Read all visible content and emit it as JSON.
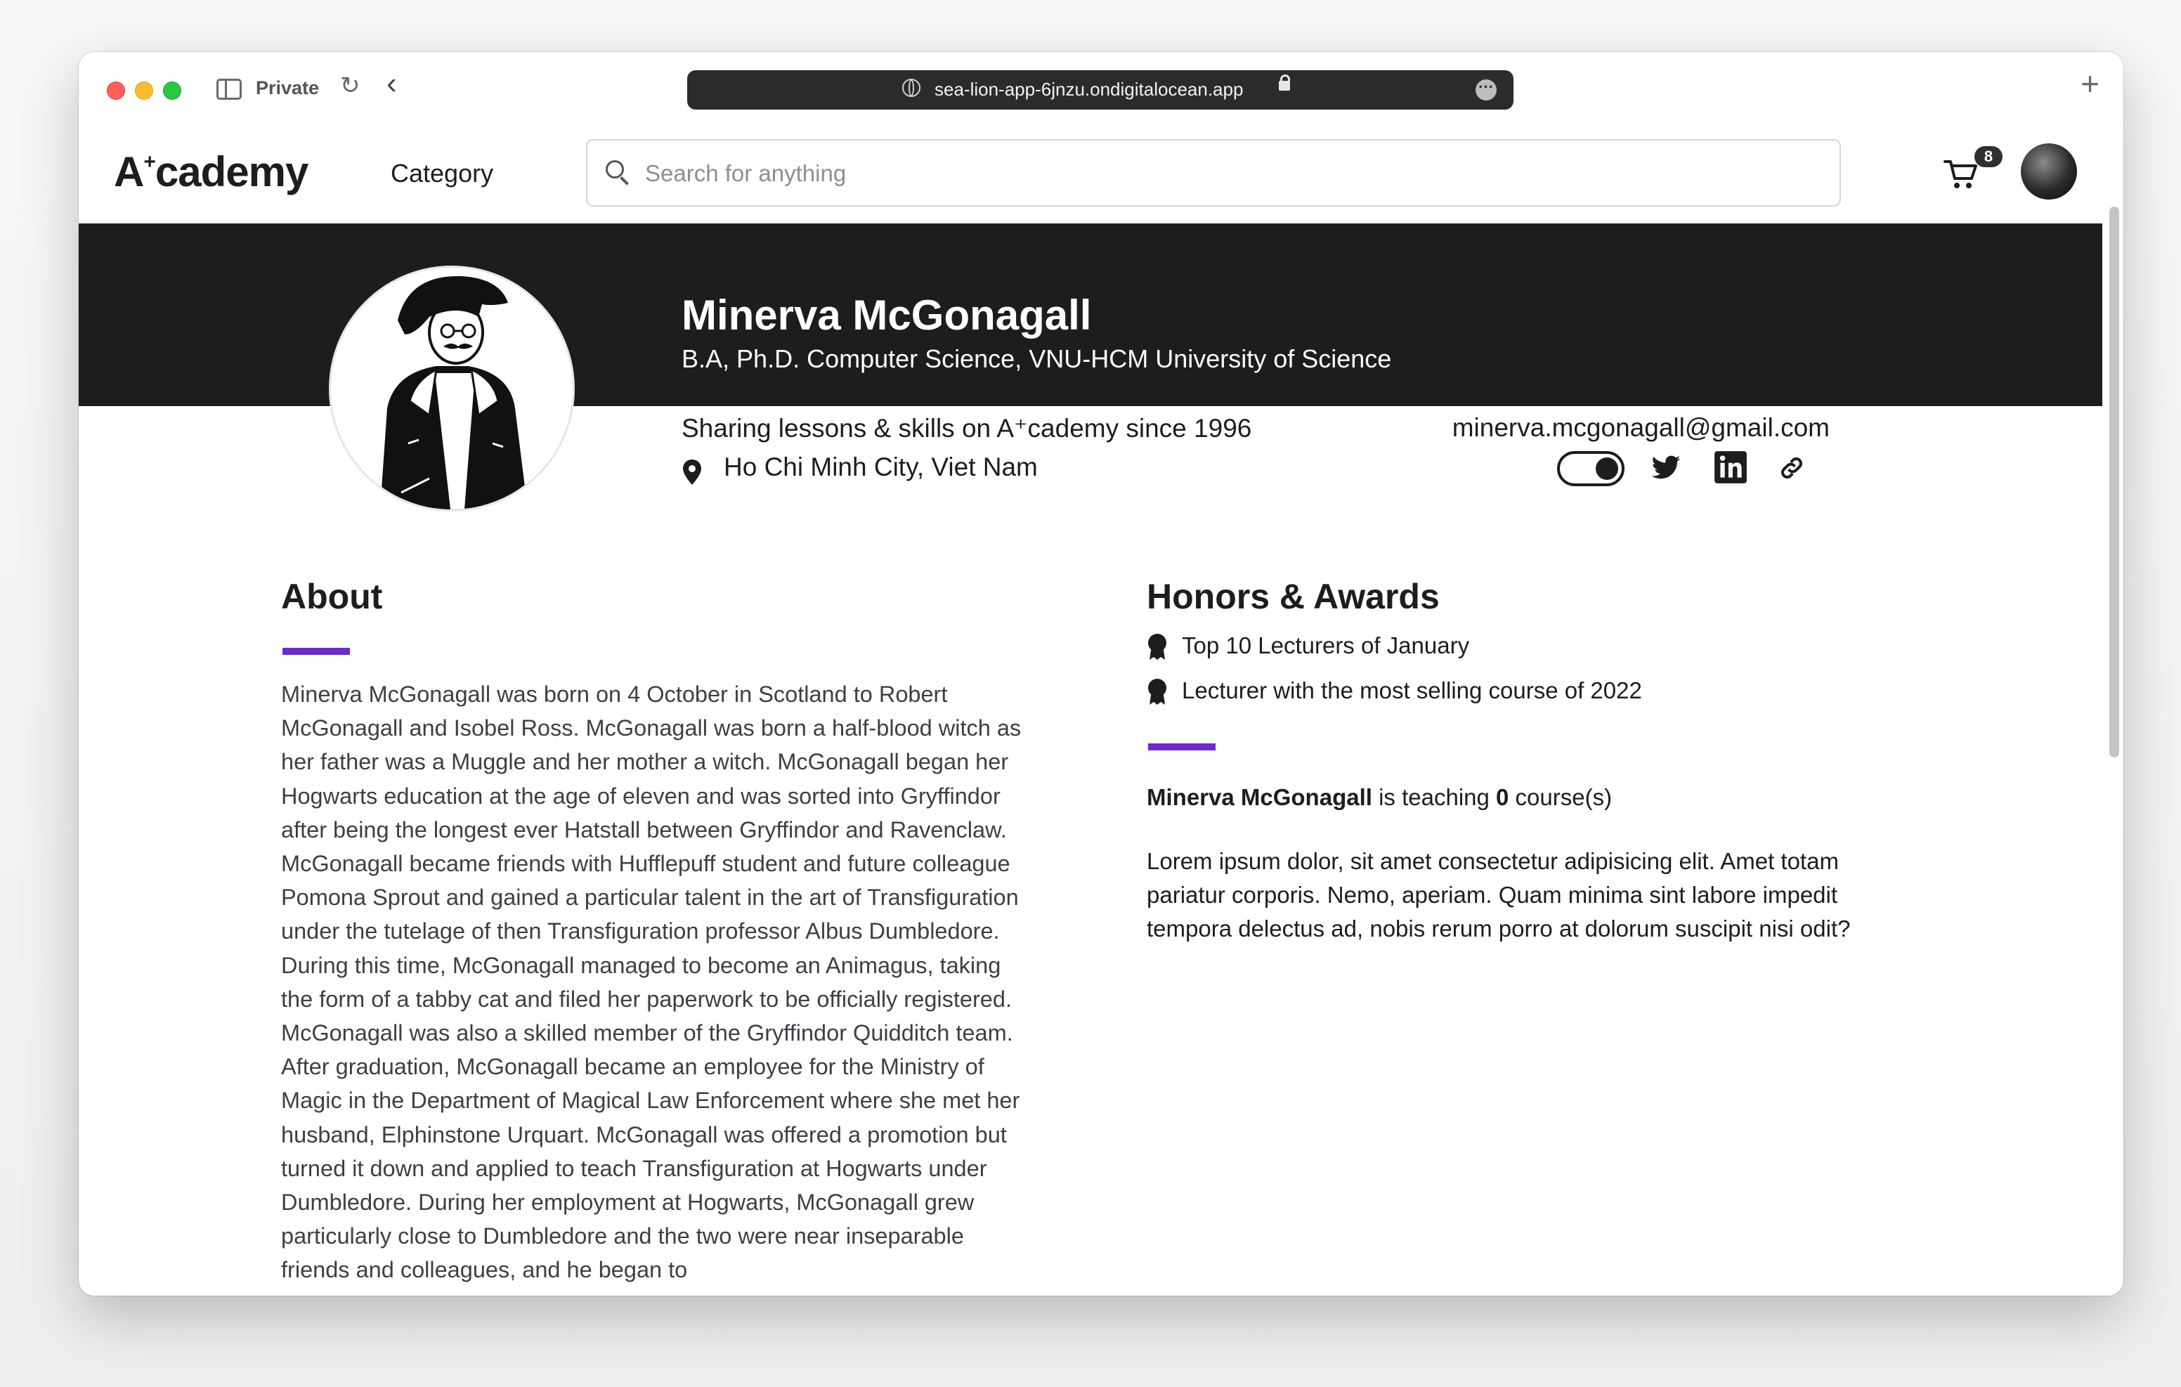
{
  "browser": {
    "mode_label": "Private",
    "url": "sea-lion-app-6jnzu.ondigitalocean.app"
  },
  "nav": {
    "logo_main": "A",
    "logo_sup": "+",
    "logo_rest": "cademy",
    "category_label": "Category",
    "search_placeholder": "Search for anything",
    "cart_count": "8"
  },
  "profile": {
    "name": "Minerva McGonagall",
    "degree": "B.A, Ph.D. Computer Science, VNU-HCM University of Science",
    "since_text": "Sharing lessons & skills on A⁺cademy since 1996",
    "location": "Ho Chi Minh City, Viet Nam",
    "email": "minerva.mcgonagall@gmail.com"
  },
  "about": {
    "title": "About",
    "text": "Minerva McGonagall was born on 4 October in Scotland to Robert McGonagall and Isobel Ross. McGonagall was born a half-blood witch as her father was a Muggle and her mother a witch. McGonagall began her Hogwarts education at the age of eleven and was sorted into Gryffindor after being the longest ever Hatstall between Gryffindor and Ravenclaw. McGonagall became friends with Hufflepuff student and future colleague Pomona Sprout and gained a particular talent in the art of Transfiguration under the tutelage of then Transfiguration professor Albus Dumbledore. During this time, McGonagall managed to become an Animagus, taking the form of a tabby cat and filed her paperwork to be officially registered. McGonagall was also a skilled member of the Gryffindor Quidditch team. After graduation, McGonagall became an employee for the Ministry of Magic in the Department of Magical Law Enforcement where she met her husband, Elphinstone Urquart. McGonagall was offered a promotion but turned it down and applied to teach Transfiguration at Hogwarts under Dumbledore. During her employment at Hogwarts, McGonagall grew particularly close to Dumbledore and the two were near inseparable friends and colleagues, and he began to"
  },
  "honors": {
    "title": "Honors & Awards",
    "items": [
      "Top 10 Lecturers of January",
      "Lecturer with the most selling course of 2022"
    ]
  },
  "teaching": {
    "name": "Minerva McGonagall",
    "middle": " is teaching ",
    "count": "0",
    "suffix": " course(s)"
  },
  "lorem": "Lorem ipsum dolor, sit amet consectetur adipisicing elit. Amet totam pariatur corporis. Nemo, aperiam. Quam minima sint labore impedit tempora delectus ad, nobis rerum porro at dolorum suscipit nisi odit?",
  "icons": [
    "sidebar-icon",
    "reload-icon",
    "back-icon",
    "globe-icon",
    "lock-icon",
    "more-icon",
    "plus-icon",
    "search-icon",
    "cart-icon",
    "location-pin-icon",
    "toggle-icon",
    "twitter-icon",
    "linkedin-icon",
    "link-icon",
    "medal-icon"
  ],
  "colors": {
    "accent": "#6d28d2",
    "banner": "#1c1d1f"
  }
}
